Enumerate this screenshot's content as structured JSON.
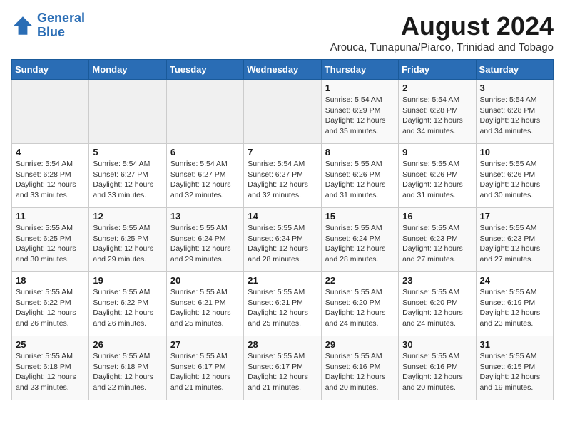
{
  "logo": {
    "line1": "General",
    "line2": "Blue"
  },
  "title": "August 2024",
  "subtitle": "Arouca, Tunapuna/Piarco, Trinidad and Tobago",
  "weekdays": [
    "Sunday",
    "Monday",
    "Tuesday",
    "Wednesday",
    "Thursday",
    "Friday",
    "Saturday"
  ],
  "weeks": [
    [
      {
        "day": "",
        "detail": ""
      },
      {
        "day": "",
        "detail": ""
      },
      {
        "day": "",
        "detail": ""
      },
      {
        "day": "",
        "detail": ""
      },
      {
        "day": "1",
        "detail": "Sunrise: 5:54 AM\nSunset: 6:29 PM\nDaylight: 12 hours\nand 35 minutes."
      },
      {
        "day": "2",
        "detail": "Sunrise: 5:54 AM\nSunset: 6:28 PM\nDaylight: 12 hours\nand 34 minutes."
      },
      {
        "day": "3",
        "detail": "Sunrise: 5:54 AM\nSunset: 6:28 PM\nDaylight: 12 hours\nand 34 minutes."
      }
    ],
    [
      {
        "day": "4",
        "detail": "Sunrise: 5:54 AM\nSunset: 6:28 PM\nDaylight: 12 hours\nand 33 minutes."
      },
      {
        "day": "5",
        "detail": "Sunrise: 5:54 AM\nSunset: 6:27 PM\nDaylight: 12 hours\nand 33 minutes."
      },
      {
        "day": "6",
        "detail": "Sunrise: 5:54 AM\nSunset: 6:27 PM\nDaylight: 12 hours\nand 32 minutes."
      },
      {
        "day": "7",
        "detail": "Sunrise: 5:54 AM\nSunset: 6:27 PM\nDaylight: 12 hours\nand 32 minutes."
      },
      {
        "day": "8",
        "detail": "Sunrise: 5:55 AM\nSunset: 6:26 PM\nDaylight: 12 hours\nand 31 minutes."
      },
      {
        "day": "9",
        "detail": "Sunrise: 5:55 AM\nSunset: 6:26 PM\nDaylight: 12 hours\nand 31 minutes."
      },
      {
        "day": "10",
        "detail": "Sunrise: 5:55 AM\nSunset: 6:26 PM\nDaylight: 12 hours\nand 30 minutes."
      }
    ],
    [
      {
        "day": "11",
        "detail": "Sunrise: 5:55 AM\nSunset: 6:25 PM\nDaylight: 12 hours\nand 30 minutes."
      },
      {
        "day": "12",
        "detail": "Sunrise: 5:55 AM\nSunset: 6:25 PM\nDaylight: 12 hours\nand 29 minutes."
      },
      {
        "day": "13",
        "detail": "Sunrise: 5:55 AM\nSunset: 6:24 PM\nDaylight: 12 hours\nand 29 minutes."
      },
      {
        "day": "14",
        "detail": "Sunrise: 5:55 AM\nSunset: 6:24 PM\nDaylight: 12 hours\nand 28 minutes."
      },
      {
        "day": "15",
        "detail": "Sunrise: 5:55 AM\nSunset: 6:24 PM\nDaylight: 12 hours\nand 28 minutes."
      },
      {
        "day": "16",
        "detail": "Sunrise: 5:55 AM\nSunset: 6:23 PM\nDaylight: 12 hours\nand 27 minutes."
      },
      {
        "day": "17",
        "detail": "Sunrise: 5:55 AM\nSunset: 6:23 PM\nDaylight: 12 hours\nand 27 minutes."
      }
    ],
    [
      {
        "day": "18",
        "detail": "Sunrise: 5:55 AM\nSunset: 6:22 PM\nDaylight: 12 hours\nand 26 minutes."
      },
      {
        "day": "19",
        "detail": "Sunrise: 5:55 AM\nSunset: 6:22 PM\nDaylight: 12 hours\nand 26 minutes."
      },
      {
        "day": "20",
        "detail": "Sunrise: 5:55 AM\nSunset: 6:21 PM\nDaylight: 12 hours\nand 25 minutes."
      },
      {
        "day": "21",
        "detail": "Sunrise: 5:55 AM\nSunset: 6:21 PM\nDaylight: 12 hours\nand 25 minutes."
      },
      {
        "day": "22",
        "detail": "Sunrise: 5:55 AM\nSunset: 6:20 PM\nDaylight: 12 hours\nand 24 minutes."
      },
      {
        "day": "23",
        "detail": "Sunrise: 5:55 AM\nSunset: 6:20 PM\nDaylight: 12 hours\nand 24 minutes."
      },
      {
        "day": "24",
        "detail": "Sunrise: 5:55 AM\nSunset: 6:19 PM\nDaylight: 12 hours\nand 23 minutes."
      }
    ],
    [
      {
        "day": "25",
        "detail": "Sunrise: 5:55 AM\nSunset: 6:18 PM\nDaylight: 12 hours\nand 23 minutes."
      },
      {
        "day": "26",
        "detail": "Sunrise: 5:55 AM\nSunset: 6:18 PM\nDaylight: 12 hours\nand 22 minutes."
      },
      {
        "day": "27",
        "detail": "Sunrise: 5:55 AM\nSunset: 6:17 PM\nDaylight: 12 hours\nand 21 minutes."
      },
      {
        "day": "28",
        "detail": "Sunrise: 5:55 AM\nSunset: 6:17 PM\nDaylight: 12 hours\nand 21 minutes."
      },
      {
        "day": "29",
        "detail": "Sunrise: 5:55 AM\nSunset: 6:16 PM\nDaylight: 12 hours\nand 20 minutes."
      },
      {
        "day": "30",
        "detail": "Sunrise: 5:55 AM\nSunset: 6:16 PM\nDaylight: 12 hours\nand 20 minutes."
      },
      {
        "day": "31",
        "detail": "Sunrise: 5:55 AM\nSunset: 6:15 PM\nDaylight: 12 hours\nand 19 minutes."
      }
    ]
  ]
}
